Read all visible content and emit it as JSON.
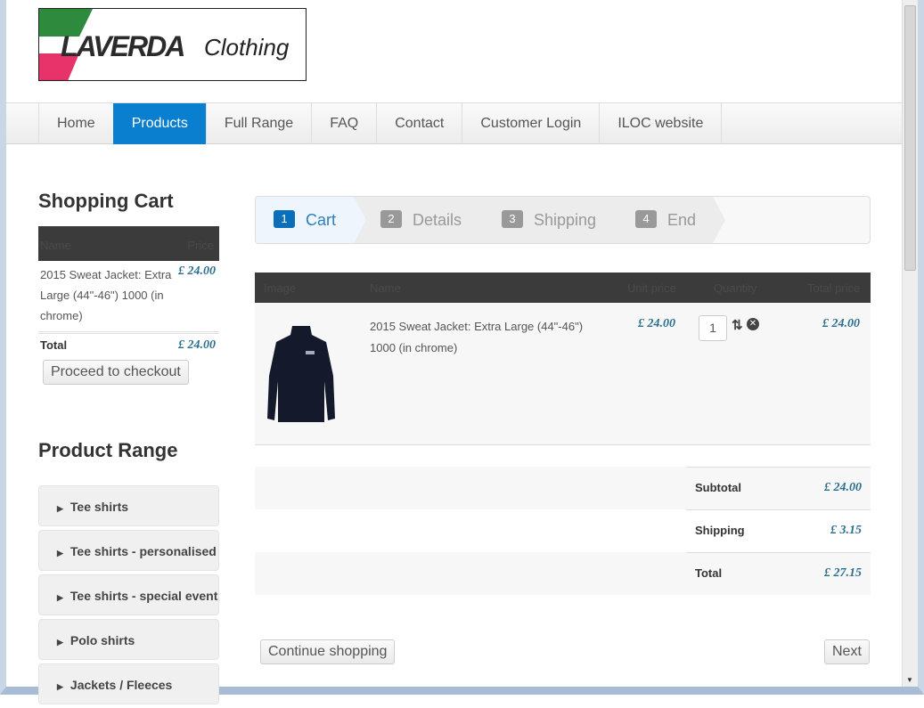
{
  "logo": {
    "brand": "LAVERDA",
    "sub": "Clothing"
  },
  "nav": [
    "Home",
    "Products",
    "Full Range",
    "FAQ",
    "Contact",
    "Customer Login",
    "ILOC website"
  ],
  "cart": {
    "title": "Shopping Cart",
    "col_name": "Name",
    "col_price": "Price",
    "item": "2015 Sweat Jacket: Extra Large (44\"-46\") 1000 (in chrome)",
    "item_price": "£ 24.00",
    "total_label": "Total",
    "total": "£ 24.00",
    "checkout": "Proceed to checkout"
  },
  "range": {
    "title": "Product Range",
    "items": [
      "Tee shirts",
      "Tee shirts - personalised",
      "Tee shirts - special event",
      "Polo shirts",
      "Jackets / Fleeces"
    ]
  },
  "steps": [
    {
      "n": "1",
      "label": "Cart"
    },
    {
      "n": "2",
      "label": "Details"
    },
    {
      "n": "3",
      "label": "Shipping"
    },
    {
      "n": "4",
      "label": "End"
    }
  ],
  "table": {
    "headers": [
      "Image",
      "Name",
      "Unit price",
      "Quantity",
      "Total price"
    ],
    "row": {
      "name": "2015 Sweat Jacket: Extra Large (44\"-46\") 1000 (in chrome)",
      "unit": "£ 24.00",
      "qty": "1",
      "total": "£ 24.00"
    }
  },
  "summary": {
    "subtotal_label": "Subtotal",
    "subtotal": "£ 24.00",
    "shipping_label": "Shipping",
    "shipping": "£ 3.15",
    "total_label": "Total",
    "total": "£ 27.15"
  },
  "buttons": {
    "continue": "Continue shopping",
    "next": "Next"
  }
}
